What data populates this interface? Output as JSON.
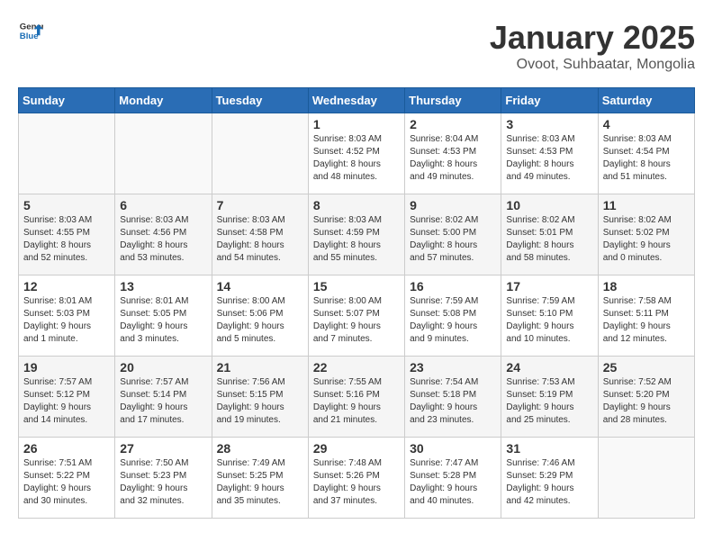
{
  "logo": {
    "general": "General",
    "blue": "Blue"
  },
  "header": {
    "title": "January 2025",
    "subtitle": "Ovoot, Suhbaatar, Mongolia"
  },
  "weekdays": [
    "Sunday",
    "Monday",
    "Tuesday",
    "Wednesday",
    "Thursday",
    "Friday",
    "Saturday"
  ],
  "weeks": [
    [
      {
        "day": "",
        "info": ""
      },
      {
        "day": "",
        "info": ""
      },
      {
        "day": "",
        "info": ""
      },
      {
        "day": "1",
        "info": "Sunrise: 8:03 AM\nSunset: 4:52 PM\nDaylight: 8 hours\nand 48 minutes."
      },
      {
        "day": "2",
        "info": "Sunrise: 8:04 AM\nSunset: 4:53 PM\nDaylight: 8 hours\nand 49 minutes."
      },
      {
        "day": "3",
        "info": "Sunrise: 8:03 AM\nSunset: 4:53 PM\nDaylight: 8 hours\nand 49 minutes."
      },
      {
        "day": "4",
        "info": "Sunrise: 8:03 AM\nSunset: 4:54 PM\nDaylight: 8 hours\nand 51 minutes."
      }
    ],
    [
      {
        "day": "5",
        "info": "Sunrise: 8:03 AM\nSunset: 4:55 PM\nDaylight: 8 hours\nand 52 minutes."
      },
      {
        "day": "6",
        "info": "Sunrise: 8:03 AM\nSunset: 4:56 PM\nDaylight: 8 hours\nand 53 minutes."
      },
      {
        "day": "7",
        "info": "Sunrise: 8:03 AM\nSunset: 4:58 PM\nDaylight: 8 hours\nand 54 minutes."
      },
      {
        "day": "8",
        "info": "Sunrise: 8:03 AM\nSunset: 4:59 PM\nDaylight: 8 hours\nand 55 minutes."
      },
      {
        "day": "9",
        "info": "Sunrise: 8:02 AM\nSunset: 5:00 PM\nDaylight: 8 hours\nand 57 minutes."
      },
      {
        "day": "10",
        "info": "Sunrise: 8:02 AM\nSunset: 5:01 PM\nDaylight: 8 hours\nand 58 minutes."
      },
      {
        "day": "11",
        "info": "Sunrise: 8:02 AM\nSunset: 5:02 PM\nDaylight: 9 hours\nand 0 minutes."
      }
    ],
    [
      {
        "day": "12",
        "info": "Sunrise: 8:01 AM\nSunset: 5:03 PM\nDaylight: 9 hours\nand 1 minute."
      },
      {
        "day": "13",
        "info": "Sunrise: 8:01 AM\nSunset: 5:05 PM\nDaylight: 9 hours\nand 3 minutes."
      },
      {
        "day": "14",
        "info": "Sunrise: 8:00 AM\nSunset: 5:06 PM\nDaylight: 9 hours\nand 5 minutes."
      },
      {
        "day": "15",
        "info": "Sunrise: 8:00 AM\nSunset: 5:07 PM\nDaylight: 9 hours\nand 7 minutes."
      },
      {
        "day": "16",
        "info": "Sunrise: 7:59 AM\nSunset: 5:08 PM\nDaylight: 9 hours\nand 9 minutes."
      },
      {
        "day": "17",
        "info": "Sunrise: 7:59 AM\nSunset: 5:10 PM\nDaylight: 9 hours\nand 10 minutes."
      },
      {
        "day": "18",
        "info": "Sunrise: 7:58 AM\nSunset: 5:11 PM\nDaylight: 9 hours\nand 12 minutes."
      }
    ],
    [
      {
        "day": "19",
        "info": "Sunrise: 7:57 AM\nSunset: 5:12 PM\nDaylight: 9 hours\nand 14 minutes."
      },
      {
        "day": "20",
        "info": "Sunrise: 7:57 AM\nSunset: 5:14 PM\nDaylight: 9 hours\nand 17 minutes."
      },
      {
        "day": "21",
        "info": "Sunrise: 7:56 AM\nSunset: 5:15 PM\nDaylight: 9 hours\nand 19 minutes."
      },
      {
        "day": "22",
        "info": "Sunrise: 7:55 AM\nSunset: 5:16 PM\nDaylight: 9 hours\nand 21 minutes."
      },
      {
        "day": "23",
        "info": "Sunrise: 7:54 AM\nSunset: 5:18 PM\nDaylight: 9 hours\nand 23 minutes."
      },
      {
        "day": "24",
        "info": "Sunrise: 7:53 AM\nSunset: 5:19 PM\nDaylight: 9 hours\nand 25 minutes."
      },
      {
        "day": "25",
        "info": "Sunrise: 7:52 AM\nSunset: 5:20 PM\nDaylight: 9 hours\nand 28 minutes."
      }
    ],
    [
      {
        "day": "26",
        "info": "Sunrise: 7:51 AM\nSunset: 5:22 PM\nDaylight: 9 hours\nand 30 minutes."
      },
      {
        "day": "27",
        "info": "Sunrise: 7:50 AM\nSunset: 5:23 PM\nDaylight: 9 hours\nand 32 minutes."
      },
      {
        "day": "28",
        "info": "Sunrise: 7:49 AM\nSunset: 5:25 PM\nDaylight: 9 hours\nand 35 minutes."
      },
      {
        "day": "29",
        "info": "Sunrise: 7:48 AM\nSunset: 5:26 PM\nDaylight: 9 hours\nand 37 minutes."
      },
      {
        "day": "30",
        "info": "Sunrise: 7:47 AM\nSunset: 5:28 PM\nDaylight: 9 hours\nand 40 minutes."
      },
      {
        "day": "31",
        "info": "Sunrise: 7:46 AM\nSunset: 5:29 PM\nDaylight: 9 hours\nand 42 minutes."
      },
      {
        "day": "",
        "info": ""
      }
    ]
  ]
}
